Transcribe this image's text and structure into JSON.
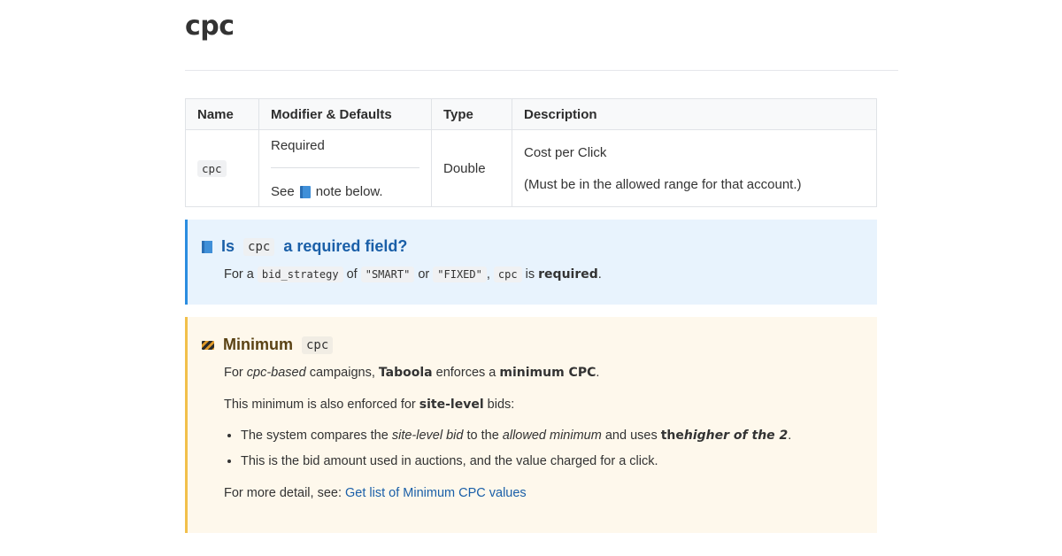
{
  "title": "cpc",
  "table": {
    "headers": [
      "Name",
      "Modifier & Defaults",
      "Type",
      "Description"
    ],
    "row": {
      "name": "cpc",
      "modifier_required": "Required",
      "modifier_see_prefix": "See",
      "modifier_see_suffix": "note below.",
      "type": "Double",
      "description_line1": "Cost per Click",
      "description_line2": "(Must be in the allowed range for that account.)"
    }
  },
  "info_callout": {
    "icon": "blue-book-icon",
    "title_prefix": "Is",
    "title_code": "cpc",
    "title_suffix": "a required field?",
    "body_for_a": "For a",
    "body_code_bid_strategy": "bid_strategy",
    "body_of": "of",
    "body_code_smart": "\"SMART\"",
    "body_or": "or",
    "body_code_fixed": "\"FIXED\"",
    "body_comma": ",",
    "body_code_cpc": "cpc",
    "body_is": "is",
    "body_required": "required",
    "body_period": "."
  },
  "warn_callout": {
    "icon": "construction-icon",
    "title": "Minimum",
    "title_code": "cpc",
    "p1_for": "For",
    "p1_cpc_based": "cpc-based",
    "p1_campaigns": "campaigns,",
    "p1_taboola": "Taboola",
    "p1_enforces": "enforces a",
    "p1_minimum_cpc": "minimum CPC",
    "p1_period": ".",
    "p2_text": "This minimum is also enforced for",
    "p2_site_level": "site-level",
    "p2_bids": "bids:",
    "b1_a": "The system compares the",
    "b1_site_level_bid": "site-level bid",
    "b1_b": "to the",
    "b1_allowed_minimum": "allowed minimum",
    "b1_c": "and uses",
    "b1_the": "the",
    "b1_higher": "higher of the 2",
    "b1_period": ".",
    "b2": "This is the bid amount used in auctions, and the value charged for a click.",
    "p3_text": "For more detail, see:",
    "p3_link": "Get list of Minimum CPC values"
  },
  "colors": {
    "info_bg": "#e8f3fd",
    "info_border": "#2b8de0",
    "warn_bg": "#fef8ec",
    "warn_border": "#f2c04b",
    "link": "#1a5fa8"
  }
}
